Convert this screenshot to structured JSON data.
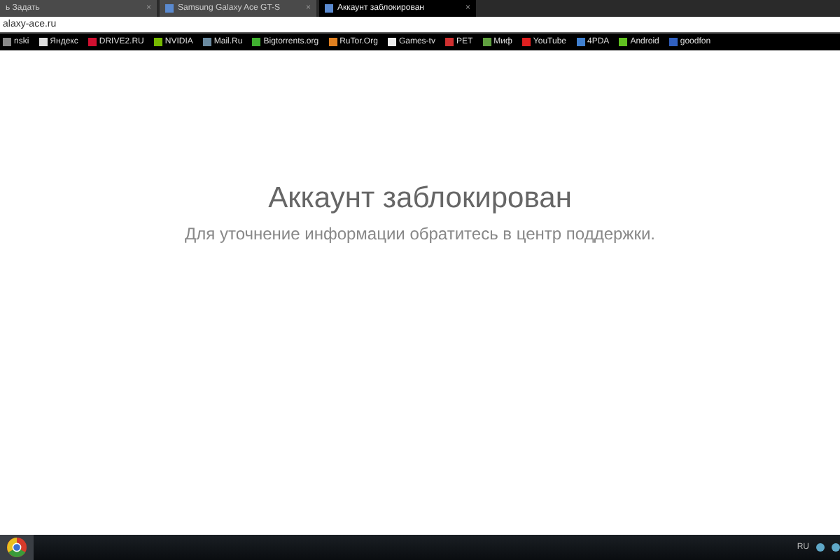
{
  "tabs": [
    {
      "label": "ь Задать",
      "selected": false,
      "close": "×"
    },
    {
      "label": "Samsung Galaxy Ace GT-S",
      "selected": false,
      "close": "×"
    },
    {
      "label": "Аккаунт заблокирован",
      "selected": true,
      "close": "×"
    }
  ],
  "address": {
    "value": "alaxy-ace.ru"
  },
  "bookmarks": [
    {
      "label": "nski",
      "color": "#888888"
    },
    {
      "label": "Яндекс",
      "color": "#dddddd"
    },
    {
      "label": "DRIVE2.RU",
      "color": "#d01030"
    },
    {
      "label": "NVIDIA",
      "color": "#76b900"
    },
    {
      "label": "Mail.Ru",
      "color": "#6a8aa0"
    },
    {
      "label": "Bigtorrents.org",
      "color": "#40b030"
    },
    {
      "label": "RuTor.Org",
      "color": "#e08020"
    },
    {
      "label": "Games-tv",
      "color": "#eeeeee"
    },
    {
      "label": "PET",
      "color": "#d03030"
    },
    {
      "label": "Миф",
      "color": "#60a040"
    },
    {
      "label": "YouTube",
      "color": "#e02020"
    },
    {
      "label": "4PDA",
      "color": "#4080d0"
    },
    {
      "label": "Android",
      "color": "#60c020"
    },
    {
      "label": "goodfon",
      "color": "#3060c0"
    }
  ],
  "page": {
    "heading": "Аккаунт заблокирован",
    "message": "Для уточнение информации обратитесь в центр поддержки."
  },
  "taskbar": {
    "language": "RU"
  }
}
